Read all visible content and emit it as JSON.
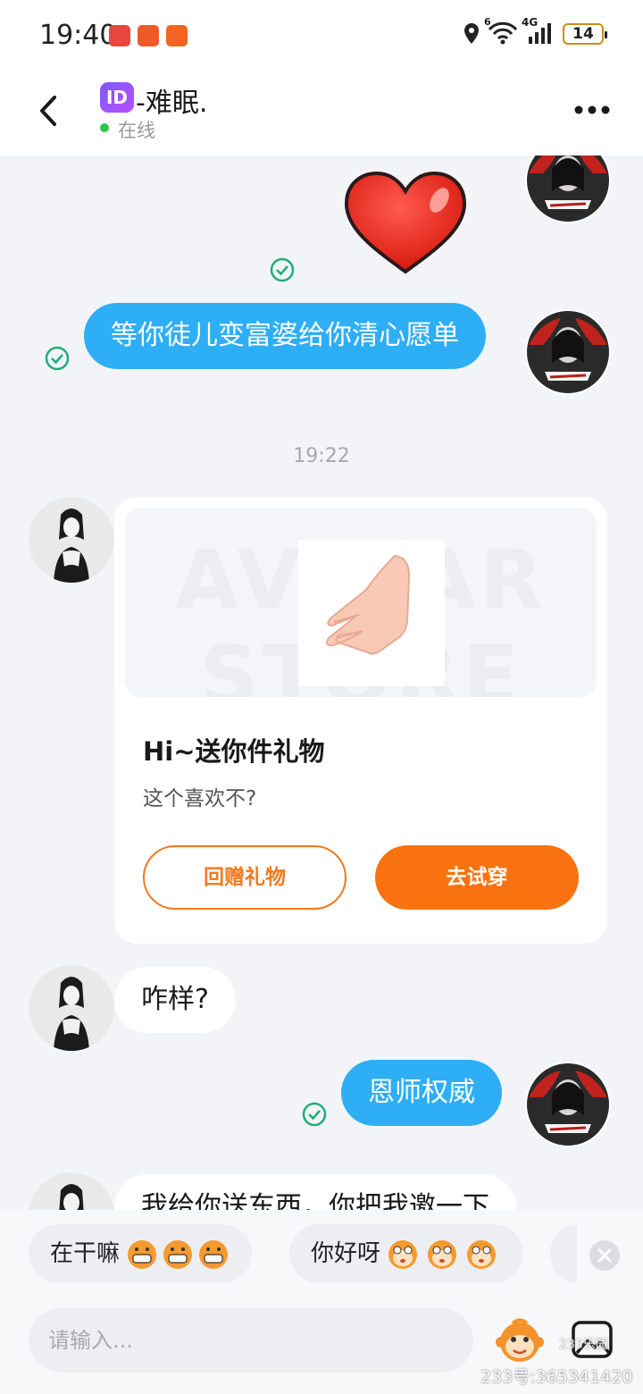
{
  "status_bar": {
    "time": "19:40",
    "battery": "14",
    "network": "4G",
    "wifi_sub": "6"
  },
  "header": {
    "id_badge": "ID",
    "name": "-难眠.",
    "status": "在线"
  },
  "messages": {
    "msg2": "等你徒儿变富婆给你清心愿单",
    "timestamp": "19:22",
    "gift": {
      "title": "Hi~送你件礼物",
      "subtitle": "这个喜欢不?",
      "return_button": "回赠礼物",
      "try_button": "去试穿",
      "watermark": "AVATAR STORE"
    },
    "msg4": "咋样?",
    "msg5": "恩师权威",
    "msg6": "我给你送东西，你把我邀一下"
  },
  "quick_replies": [
    {
      "label": "在干嘛"
    },
    {
      "label": "你好呀"
    }
  ],
  "input": {
    "placeholder": "请输入..."
  },
  "watermark": {
    "text": "233号:365341420",
    "logo": "233乐园"
  },
  "colors": {
    "outgoing_bubble": "#2eaef5",
    "accent_orange": "#f8730f",
    "online": "#29c34a",
    "check": "#1fae7a"
  }
}
